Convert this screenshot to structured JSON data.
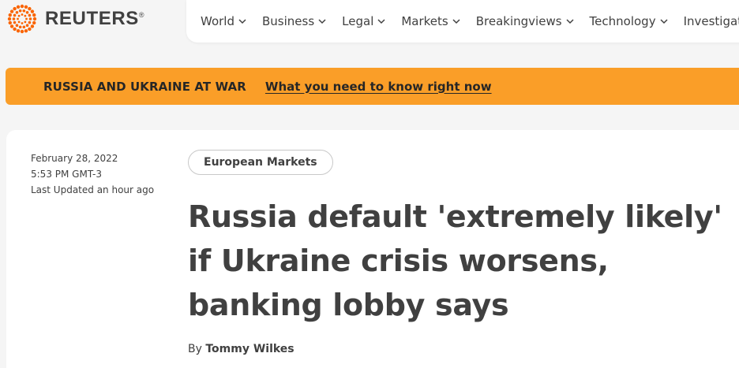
{
  "header": {
    "logo_text": "REUTERS",
    "logo_mark": "®",
    "brand_color": "#fa6400",
    "nav": [
      {
        "label": "World",
        "icon": "chevron-down-icon"
      },
      {
        "label": "Business",
        "icon": "chevron-down-icon"
      },
      {
        "label": "Legal",
        "icon": "chevron-down-icon"
      },
      {
        "label": "Markets",
        "icon": "chevron-down-icon"
      },
      {
        "label": "Breakingviews",
        "icon": "chevron-down-icon"
      },
      {
        "label": "Technology",
        "icon": "chevron-down-icon"
      },
      {
        "label": "Investigations",
        "icon": null
      }
    ]
  },
  "banner": {
    "label": "RUSSIA AND UKRAINE AT WAR",
    "link": "What you need to know right now",
    "color": "#fa9e28"
  },
  "article": {
    "date": "February 28, 2022",
    "time": "5:53 PM GMT-3",
    "updated": "Last Updated an hour ago",
    "tag": "European Markets",
    "headline": "Russia default 'extremely likely' if Ukraine crisis worsens, banking lobby says",
    "byline_prefix": "By",
    "author": "Tommy Wilkes"
  }
}
